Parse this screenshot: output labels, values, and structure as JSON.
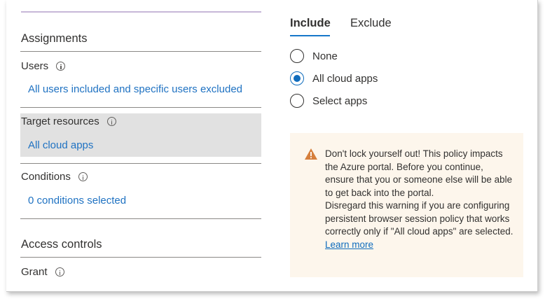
{
  "assignments": {
    "heading": "Assignments",
    "users": {
      "label": "Users",
      "value": "All users included and specific users excluded"
    },
    "target_resources": {
      "label": "Target resources",
      "value": "All cloud apps"
    },
    "conditions": {
      "label": "Conditions",
      "value": "0 conditions selected"
    }
  },
  "access_controls": {
    "heading": "Access controls",
    "grant": {
      "label": "Grant"
    }
  },
  "tabs": [
    {
      "label": "Include",
      "selected": true
    },
    {
      "label": "Exclude",
      "selected": false
    }
  ],
  "radio_options": [
    {
      "label": "None",
      "checked": false
    },
    {
      "label": "All cloud apps",
      "checked": true
    },
    {
      "label": "Select apps",
      "checked": false
    }
  ],
  "warning": {
    "icon": "warning-triangle-icon",
    "text1": "Don't lock yourself out! This policy impacts the Azure portal. Before you continue, ensure that you or someone else will be able to get back into the portal.",
    "text2": "Disregard this warning if you are configuring persistent browser session policy that works correctly only if \"All cloud apps\" are selected.",
    "link": "Learn more"
  },
  "colors": {
    "link": "#1f72c2",
    "accent": "#0f6cbd",
    "warning_icon": "#d67f3c",
    "warning_bg": "#fdf6ec",
    "highlight_bg": "#e1e1e1"
  }
}
